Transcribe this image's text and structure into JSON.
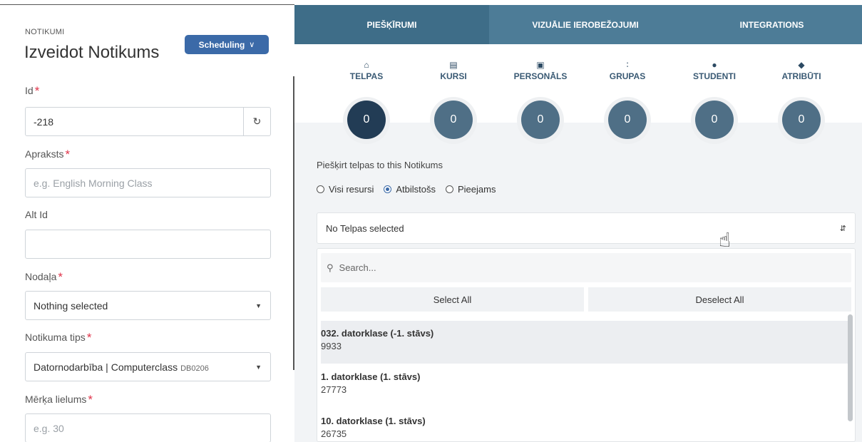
{
  "left": {
    "breadcrumb": "NOTIKUMI",
    "title": "Izveidot Notikums",
    "scheduling_button": "Scheduling",
    "fields": {
      "id": {
        "label": "Id",
        "required": "*",
        "value": "-218"
      },
      "apraksts": {
        "label": "Apraksts",
        "required": "*",
        "placeholder": "e.g. English Morning Class"
      },
      "alt_id": {
        "label": "Alt Id",
        "value": ""
      },
      "nodala": {
        "label": "Nodaļa",
        "required": "*",
        "value": "Nothing selected"
      },
      "notikuma_tips": {
        "label": "Notikuma tips",
        "required": "*",
        "value": "Datornodarbība | Computerclass",
        "code": "DB0206"
      },
      "merka_lielums": {
        "label": "Mērķa lielums",
        "required": "*",
        "placeholder": "e.g. 30"
      }
    }
  },
  "right": {
    "tabs": [
      {
        "label": "PIEŠĶĪRUMI",
        "active": true
      },
      {
        "label": "VIZUĀLIE IEROBEŽOJUMI",
        "active": false
      },
      {
        "label": "INTEGRATIONS",
        "active": false
      }
    ],
    "resources": [
      {
        "label": "TELPAS",
        "icon": "home-icon",
        "count": "0",
        "active": true
      },
      {
        "label": "KURSI",
        "icon": "document-icon",
        "count": "0",
        "active": false
      },
      {
        "label": "PERSONĀLS",
        "icon": "id-card-icon",
        "count": "0",
        "active": false
      },
      {
        "label": "GRUPAS",
        "icon": "users-icon",
        "count": "0",
        "active": false
      },
      {
        "label": "STUDENTI",
        "icon": "user-icon",
        "count": "0",
        "active": false
      },
      {
        "label": "ATRIBŪTI",
        "icon": "tag-icon",
        "count": "0",
        "active": false
      }
    ],
    "assign_label": "Piešķirt telpas to this Notikums",
    "radio_options": [
      {
        "label": "Visi resursi",
        "checked": false
      },
      {
        "label": "Atbilstošs",
        "checked": true
      },
      {
        "label": "Pieejams",
        "checked": false
      }
    ],
    "select_text": "No Telpas selected",
    "dropdown": {
      "search_placeholder": "Search...",
      "select_all": "Select All",
      "deselect_all": "Deselect All",
      "options": [
        {
          "name": "032. datorklase (-1. stāvs)",
          "code": "9933",
          "highlighted": true
        },
        {
          "name": "1. datorklase (1. stāvs)",
          "code": "27773",
          "highlighted": false
        },
        {
          "name": "10. datorklase (1. stāvs)",
          "code": "26735",
          "highlighted": false
        }
      ]
    }
  },
  "colors": {
    "tab_bar": "#4d7c97",
    "tab_active": "#3e6d88",
    "circle": "#4f6f86",
    "circle_active": "#223c55",
    "button": "#3b6aa8",
    "required": "#e0344a"
  }
}
